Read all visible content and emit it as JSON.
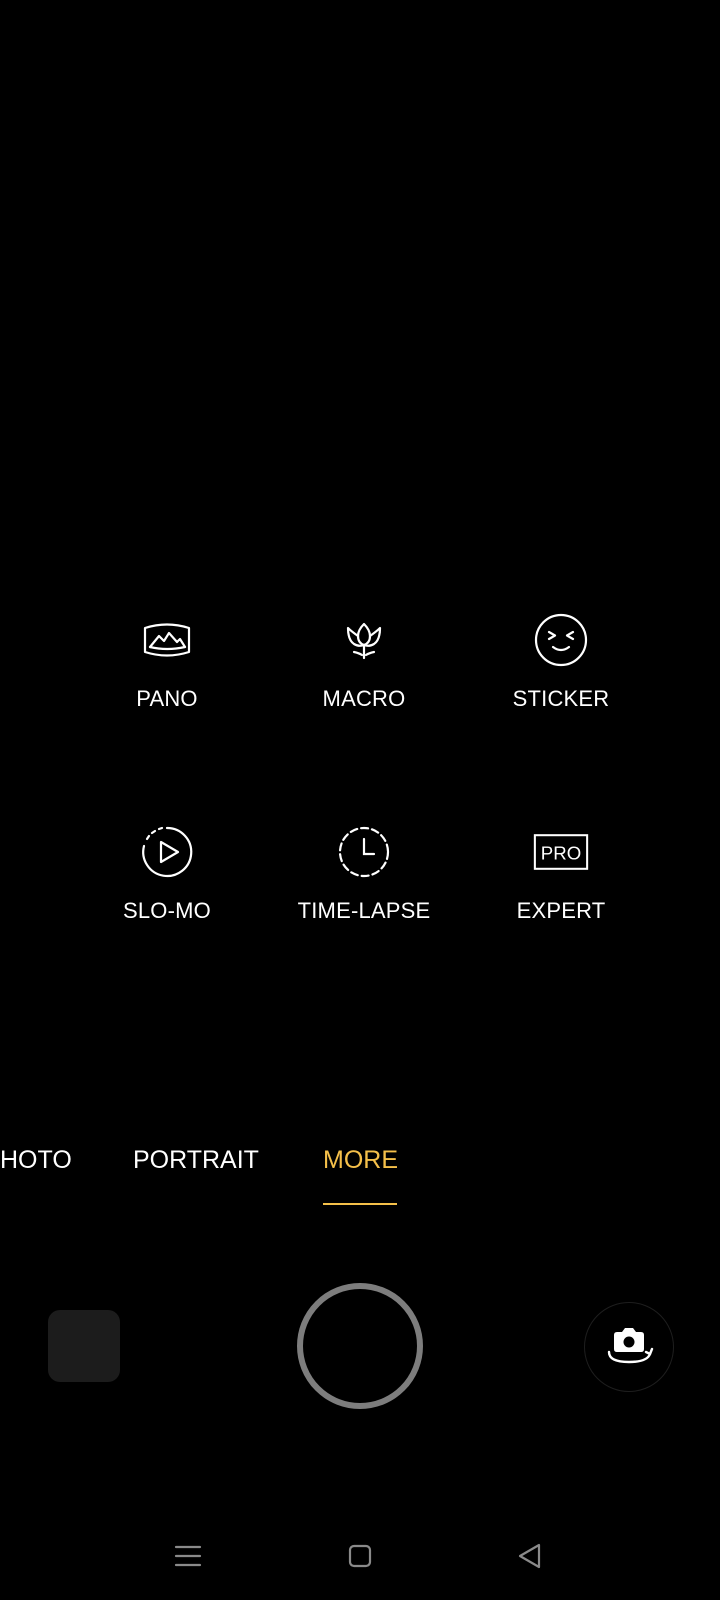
{
  "modes": [
    {
      "label": "PANO",
      "icon": "panorama-icon"
    },
    {
      "label": "MACRO",
      "icon": "macro-flower-icon"
    },
    {
      "label": "STICKER",
      "icon": "sticker-face-icon"
    },
    {
      "label": "SLO-MO",
      "icon": "slow-motion-icon"
    },
    {
      "label": "TIME-LAPSE",
      "icon": "time-lapse-clock-icon"
    },
    {
      "label": "EXPERT",
      "icon": "pro-icon",
      "icon_text": "PRO"
    }
  ],
  "mode_tabs": [
    {
      "label": "HOTO",
      "active": false
    },
    {
      "label": "PORTRAIT",
      "active": false
    },
    {
      "label": "MORE",
      "active": true
    }
  ],
  "colors": {
    "background": "#000000",
    "accent": "#f5c04a",
    "text": "#ffffff",
    "shutter_ring": "#7d7d7d",
    "nav_icon": "#8a8a8a"
  },
  "controls": {
    "thumbnail": "gallery-thumbnail",
    "shutter": "shutter-button",
    "flip": "flip-camera-icon"
  },
  "nav": [
    "menu-icon",
    "home-square-icon",
    "back-triangle-icon"
  ]
}
